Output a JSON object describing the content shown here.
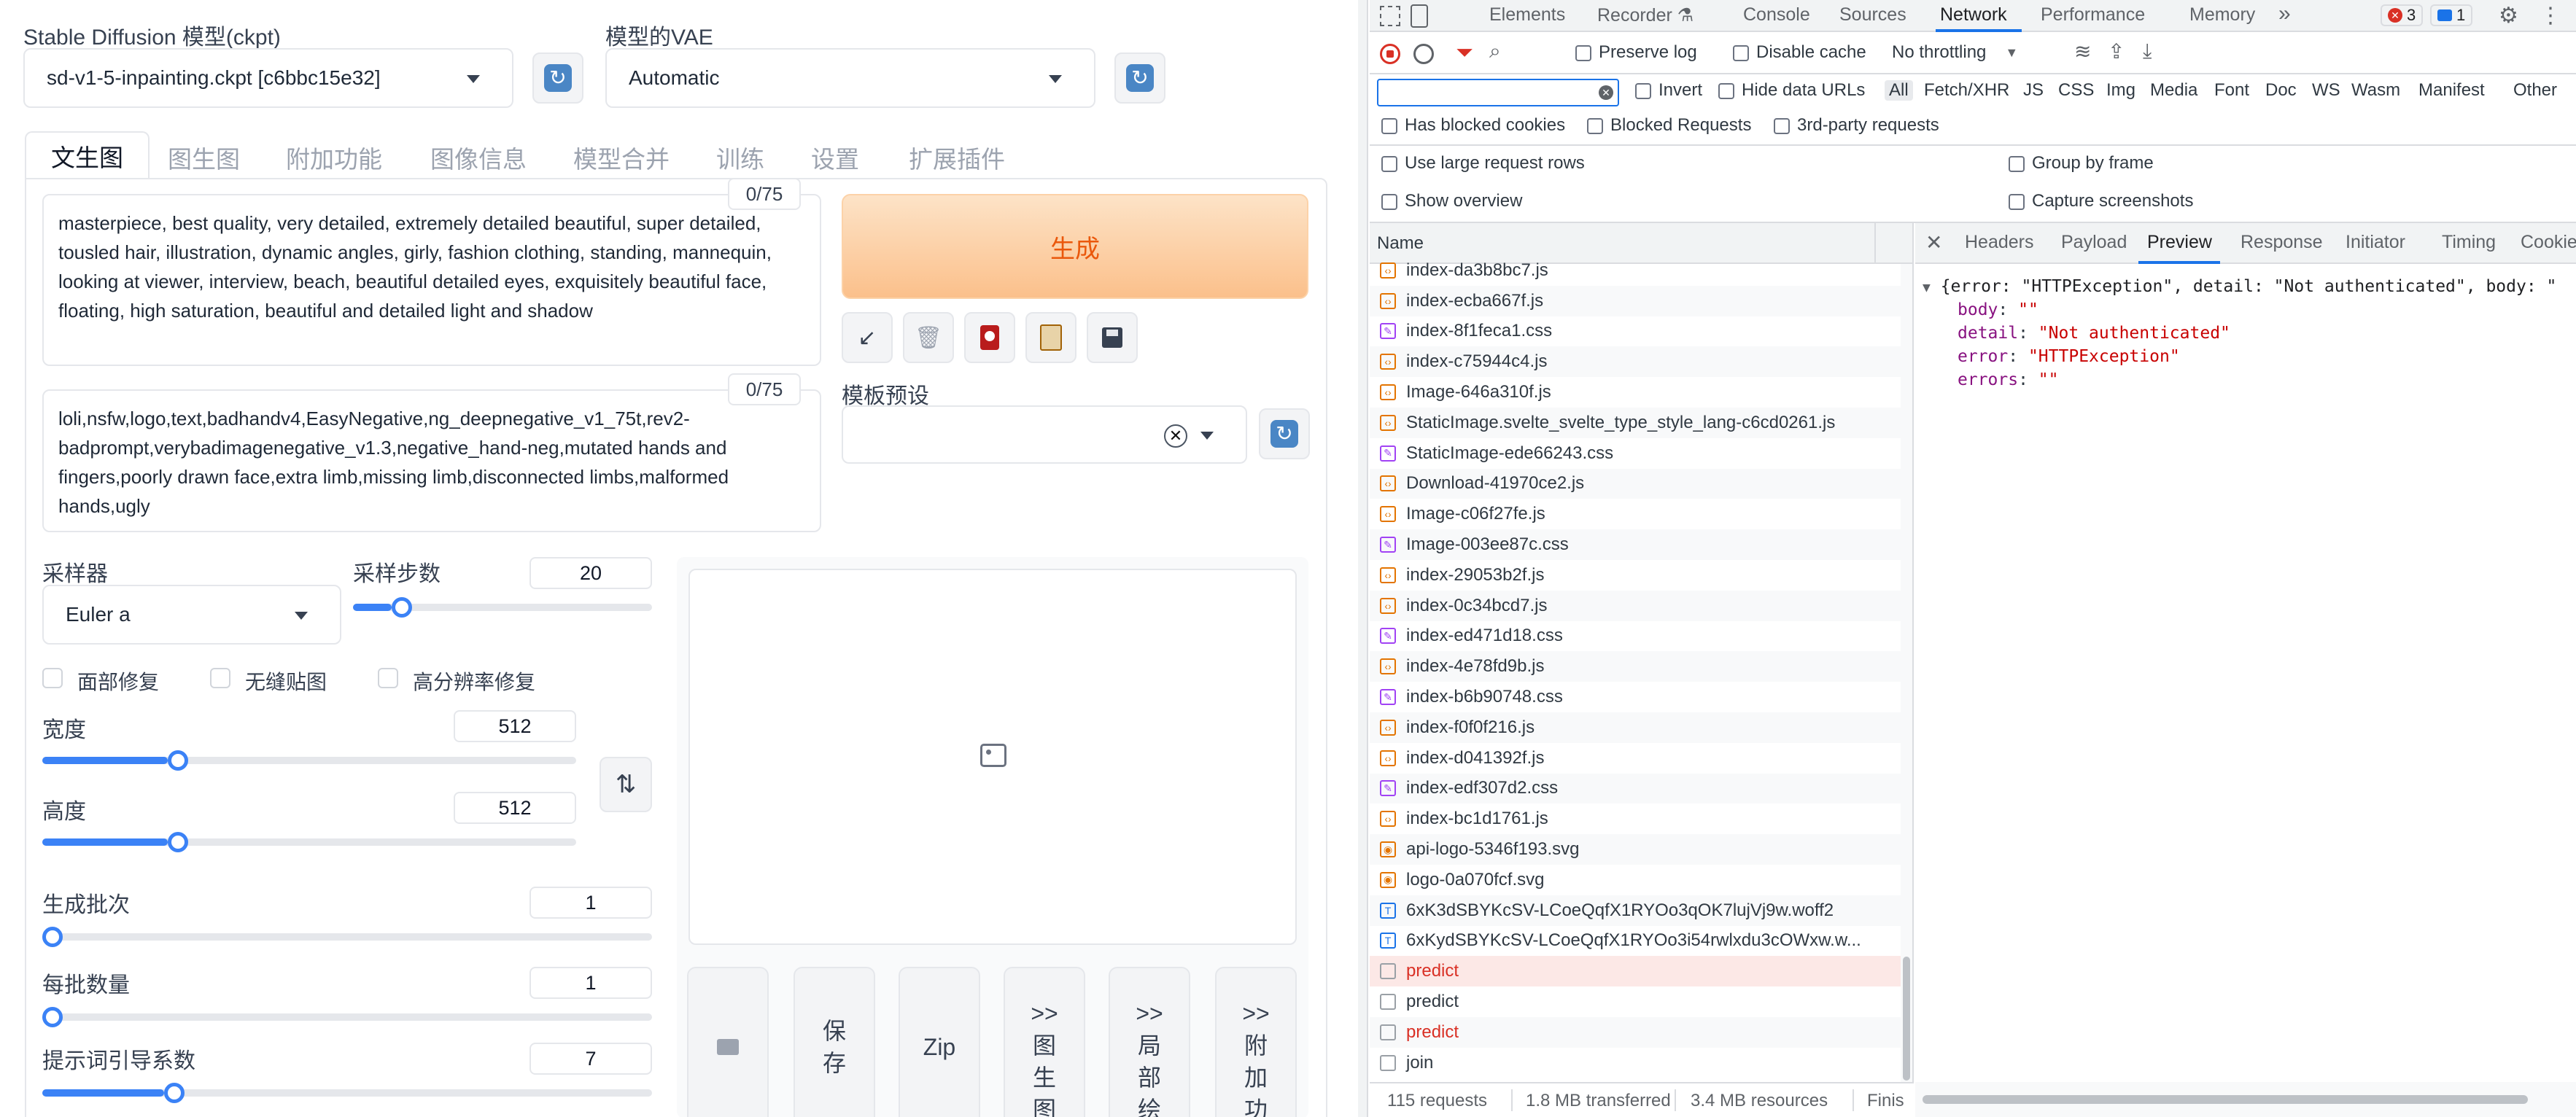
{
  "sd": {
    "model_label": "Stable Diffusion 模型(ckpt)",
    "model_value": "sd-v1-5-inpainting.ckpt [c6bbc15e32]",
    "vae_label": "模型的VAE",
    "vae_value": "Automatic",
    "tabs": [
      "文生图",
      "图生图",
      "附加功能",
      "图像信息",
      "模型合并",
      "训练",
      "设置",
      "扩展插件"
    ],
    "prompt_counter": "0/75",
    "prompt_text": "masterpiece, best quality, very detailed, extremely detailed beautiful, super detailed, tousled hair, illustration, dynamic angles, girly, fashion clothing, standing, mannequin, looking at viewer, interview, beach, beautiful detailed eyes, exquisitely beautiful face, floating, high saturation, beautiful and detailed light and shadow",
    "neg_counter": "0/75",
    "neg_text": "loli,nsfw,logo,text,badhandv4,EasyNegative,ng_deepnegative_v1_75t,rev2-badprompt,verybadimagenegative_v1.3,negative_hand-neg,mutated hands and fingers,poorly drawn face,extra limb,missing limb,disconnected limbs,malformed hands,ugly",
    "generate_label": "生成",
    "style_label": "模板预设",
    "sampler_label": "采样器",
    "sampler_value": "Euler a",
    "steps_label": "采样步数",
    "steps_value": "20",
    "steps_fraction": 0.13,
    "restore_faces": "面部修复",
    "tiling": "无缝贴图",
    "hires_fix": "高分辨率修复",
    "width_label": "宽度",
    "width_value": "512",
    "width_fraction": 0.235,
    "height_label": "高度",
    "height_value": "512",
    "height_fraction": 0.235,
    "batch_count_label": "生成批次",
    "batch_count_value": "1",
    "batch_count_fraction": 0.0,
    "batch_size_label": "每批数量",
    "batch_size_value": "1",
    "batch_size_fraction": 0.0,
    "cfg_label": "提示词引导系数",
    "cfg_value": "7",
    "cfg_fraction": 0.2,
    "out_buttons": [
      "保存",
      "Zip",
      ">>图生图",
      ">>局部绘",
      ">>附加功"
    ]
  },
  "devtools": {
    "tabs": [
      "Elements",
      "Console",
      "Sources",
      "Network",
      "Performance",
      "Memory"
    ],
    "recorder_tab": "Recorder",
    "error_count": "3",
    "message_count": "1",
    "preserve_log": "Preserve log",
    "disable_cache": "Disable cache",
    "throttling": "No throttling",
    "invert": "Invert",
    "hide_data_urls": "Hide data URLs",
    "filters": [
      "All",
      "Fetch/XHR",
      "JS",
      "CSS",
      "Img",
      "Media",
      "Font",
      "Doc",
      "WS",
      "Wasm",
      "Manifest",
      "Other"
    ],
    "has_blocked_cookies": "Has blocked cookies",
    "blocked_requests": "Blocked Requests",
    "third_party": "3rd-party requests",
    "large_rows": "Use large request rows",
    "group_by_frame": "Group by frame",
    "show_overview": "Show overview",
    "capture_screenshots": "Capture screenshots",
    "name_header": "Name",
    "requests": [
      {
        "name": "index-da3b8bc7.js",
        "type": "js",
        "error": false
      },
      {
        "name": "index-ecba667f.js",
        "type": "js",
        "error": false
      },
      {
        "name": "index-8f1feca1.css",
        "type": "css",
        "error": false
      },
      {
        "name": "index-c75944c4.js",
        "type": "js",
        "error": false
      },
      {
        "name": "Image-646a310f.js",
        "type": "js",
        "error": false
      },
      {
        "name": "StaticImage.svelte_svelte_type_style_lang-c6cd0261.js",
        "type": "js",
        "error": false
      },
      {
        "name": "StaticImage-ede66243.css",
        "type": "css",
        "error": false
      },
      {
        "name": "Download-41970ce2.js",
        "type": "js",
        "error": false
      },
      {
        "name": "Image-c06f27fe.js",
        "type": "js",
        "error": false
      },
      {
        "name": "Image-003ee87c.css",
        "type": "css",
        "error": false
      },
      {
        "name": "index-29053b2f.js",
        "type": "js",
        "error": false
      },
      {
        "name": "index-0c34bcd7.js",
        "type": "js",
        "error": false
      },
      {
        "name": "index-ed471d18.css",
        "type": "css",
        "error": false
      },
      {
        "name": "index-4e78fd9b.js",
        "type": "js",
        "error": false
      },
      {
        "name": "index-b6b90748.css",
        "type": "css",
        "error": false
      },
      {
        "name": "index-f0f0f216.js",
        "type": "js",
        "error": false
      },
      {
        "name": "index-d041392f.js",
        "type": "js",
        "error": false
      },
      {
        "name": "index-edf307d2.css",
        "type": "css",
        "error": false
      },
      {
        "name": "index-bc1d1761.js",
        "type": "js",
        "error": false
      },
      {
        "name": "api-logo-5346f193.svg",
        "type": "svg",
        "error": false
      },
      {
        "name": "logo-0a070fcf.svg",
        "type": "svg",
        "error": false
      },
      {
        "name": "6xK3dSBYKcSV-LCoeQqfX1RYOo3qOK7lujVj9w.woff2",
        "type": "font",
        "error": false
      },
      {
        "name": "6xKydSBYKcSV-LCoeQqfX1RYOo3i54rwlxdu3cOWxw.w...",
        "type": "font",
        "error": false
      },
      {
        "name": "predict",
        "type": "doc",
        "error": true
      },
      {
        "name": "predict",
        "type": "doc",
        "error": false
      },
      {
        "name": "predict",
        "type": "doc",
        "error": true
      },
      {
        "name": "join",
        "type": "doc",
        "error": false
      }
    ],
    "detail_tabs": [
      "Headers",
      "Payload",
      "Preview",
      "Response",
      "Initiator",
      "Timing",
      "Cookies"
    ],
    "preview_summary": "{error: \"HTTPException\", detail: \"Not authenticated\", body: \"",
    "preview_fields": [
      {
        "key": "body",
        "value": "\"\""
      },
      {
        "key": "detail",
        "value": "\"Not authenticated\""
      },
      {
        "key": "error",
        "value": "\"HTTPException\""
      },
      {
        "key": "errors",
        "value": "\"\""
      }
    ],
    "status_requests": "115 requests",
    "status_transferred": "1.8 MB transferred",
    "status_resources": "3.4 MB resources",
    "status_finish": "Finis"
  },
  "colors": {
    "accent": "#1a73e8",
    "error": "#d93025",
    "generate": "#ea580c",
    "slider": "#3b82f6"
  }
}
